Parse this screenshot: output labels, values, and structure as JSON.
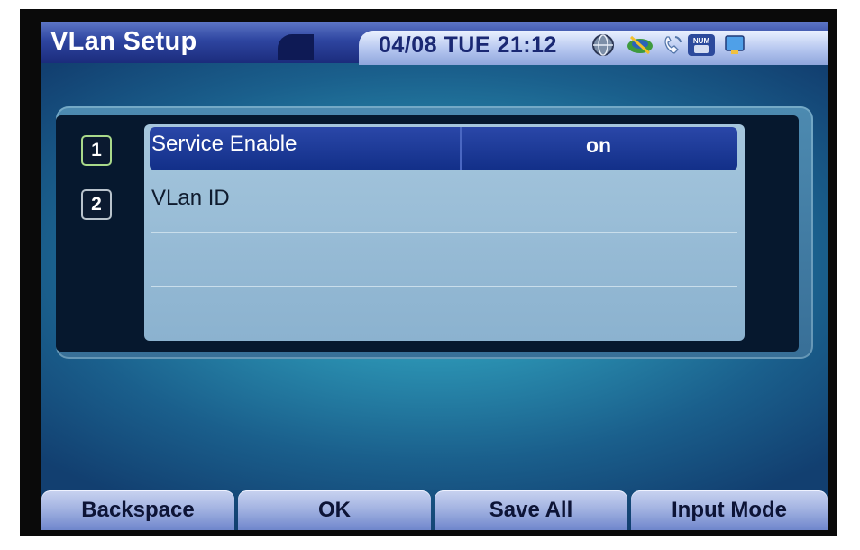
{
  "header": {
    "title": "VLan Setup",
    "datetime": "04/08 TUE 21:12",
    "status_icons": [
      "globe-icon",
      "network-icon",
      "phone-icon",
      "num-lock-icon",
      "monitor-icon"
    ],
    "num_label": "NUM"
  },
  "list": {
    "items": [
      {
        "index": "1",
        "label": "Service Enable",
        "value": "on",
        "selected": true
      },
      {
        "index": "2",
        "label": "VLan ID",
        "value": ""
      }
    ]
  },
  "softkeys": [
    "Backspace",
    "OK",
    "Save All",
    "Input Mode"
  ],
  "colors": {
    "header_dark": "#1b2c7c",
    "selection": "#122f88",
    "list_bg": "#8bb2cf",
    "softkey": "#9fb0e0"
  }
}
